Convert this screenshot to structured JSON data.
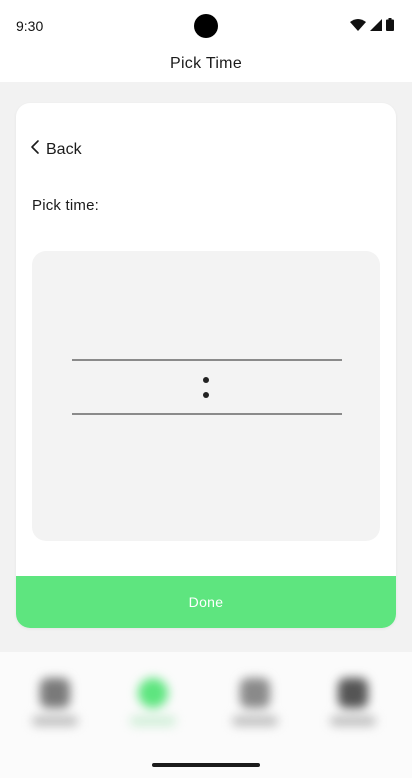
{
  "status_bar": {
    "time": "9:30"
  },
  "header": {
    "title": "Pick Time"
  },
  "card": {
    "back_label": "Back",
    "pick_label": "Pick time:",
    "done_label": "Done"
  },
  "time_picker": {
    "hour": "",
    "minute": ""
  },
  "bottom_nav": {
    "items": [
      {
        "icon": "search-icon",
        "active": false
      },
      {
        "icon": "circle-icon",
        "active": true
      },
      {
        "icon": "person-icon",
        "active": false
      },
      {
        "icon": "settings-icon",
        "active": false
      }
    ]
  },
  "colors": {
    "accent": "#5ee57f",
    "picker_background": "#f3f3f3",
    "background": "#f2f2f2"
  }
}
